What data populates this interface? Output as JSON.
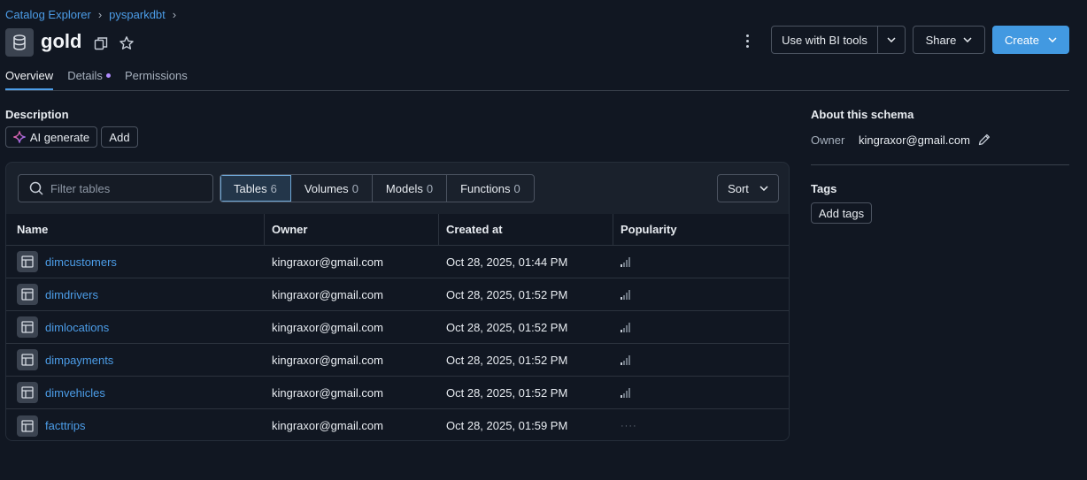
{
  "breadcrumb": [
    {
      "label": "Catalog Explorer"
    },
    {
      "label": "pysparkdbt"
    }
  ],
  "header": {
    "title": "gold",
    "use_bi_label": "Use with BI tools",
    "share_label": "Share",
    "create_label": "Create"
  },
  "tabs": [
    {
      "label": "Overview",
      "active": true
    },
    {
      "label": "Details",
      "dot": true
    },
    {
      "label": "Permissions"
    }
  ],
  "description": {
    "label": "Description",
    "ai_label": "AI generate",
    "add_label": "Add"
  },
  "filter": {
    "placeholder": "Filter tables"
  },
  "segments": [
    {
      "label": "Tables",
      "count": "6",
      "active": true
    },
    {
      "label": "Volumes",
      "count": "0"
    },
    {
      "label": "Models",
      "count": "0"
    },
    {
      "label": "Functions",
      "count": "0"
    }
  ],
  "sort_label": "Sort",
  "table": {
    "columns": [
      "Name",
      "Owner",
      "Created at",
      "Popularity"
    ],
    "rows": [
      {
        "name": "dimcustomers",
        "owner": "kingraxor@gmail.com",
        "created": "Oct 28, 2025, 01:44 PM",
        "popularity": 1
      },
      {
        "name": "dimdrivers",
        "owner": "kingraxor@gmail.com",
        "created": "Oct 28, 2025, 01:52 PM",
        "popularity": 1
      },
      {
        "name": "dimlocations",
        "owner": "kingraxor@gmail.com",
        "created": "Oct 28, 2025, 01:52 PM",
        "popularity": 1
      },
      {
        "name": "dimpayments",
        "owner": "kingraxor@gmail.com",
        "created": "Oct 28, 2025, 01:52 PM",
        "popularity": 1
      },
      {
        "name": "dimvehicles",
        "owner": "kingraxor@gmail.com",
        "created": "Oct 28, 2025, 01:52 PM",
        "popularity": 1
      },
      {
        "name": "facttrips",
        "owner": "kingraxor@gmail.com",
        "created": "Oct 28, 2025, 01:59 PM",
        "popularity": 0
      }
    ]
  },
  "about": {
    "label": "About this schema",
    "owner_label": "Owner",
    "owner_value": "kingraxor@gmail.com"
  },
  "tags": {
    "label": "Tags",
    "add_label": "Add tags"
  },
  "colors": {
    "background": "#111722",
    "accent": "#4299e1",
    "link": "#4c9de8"
  }
}
